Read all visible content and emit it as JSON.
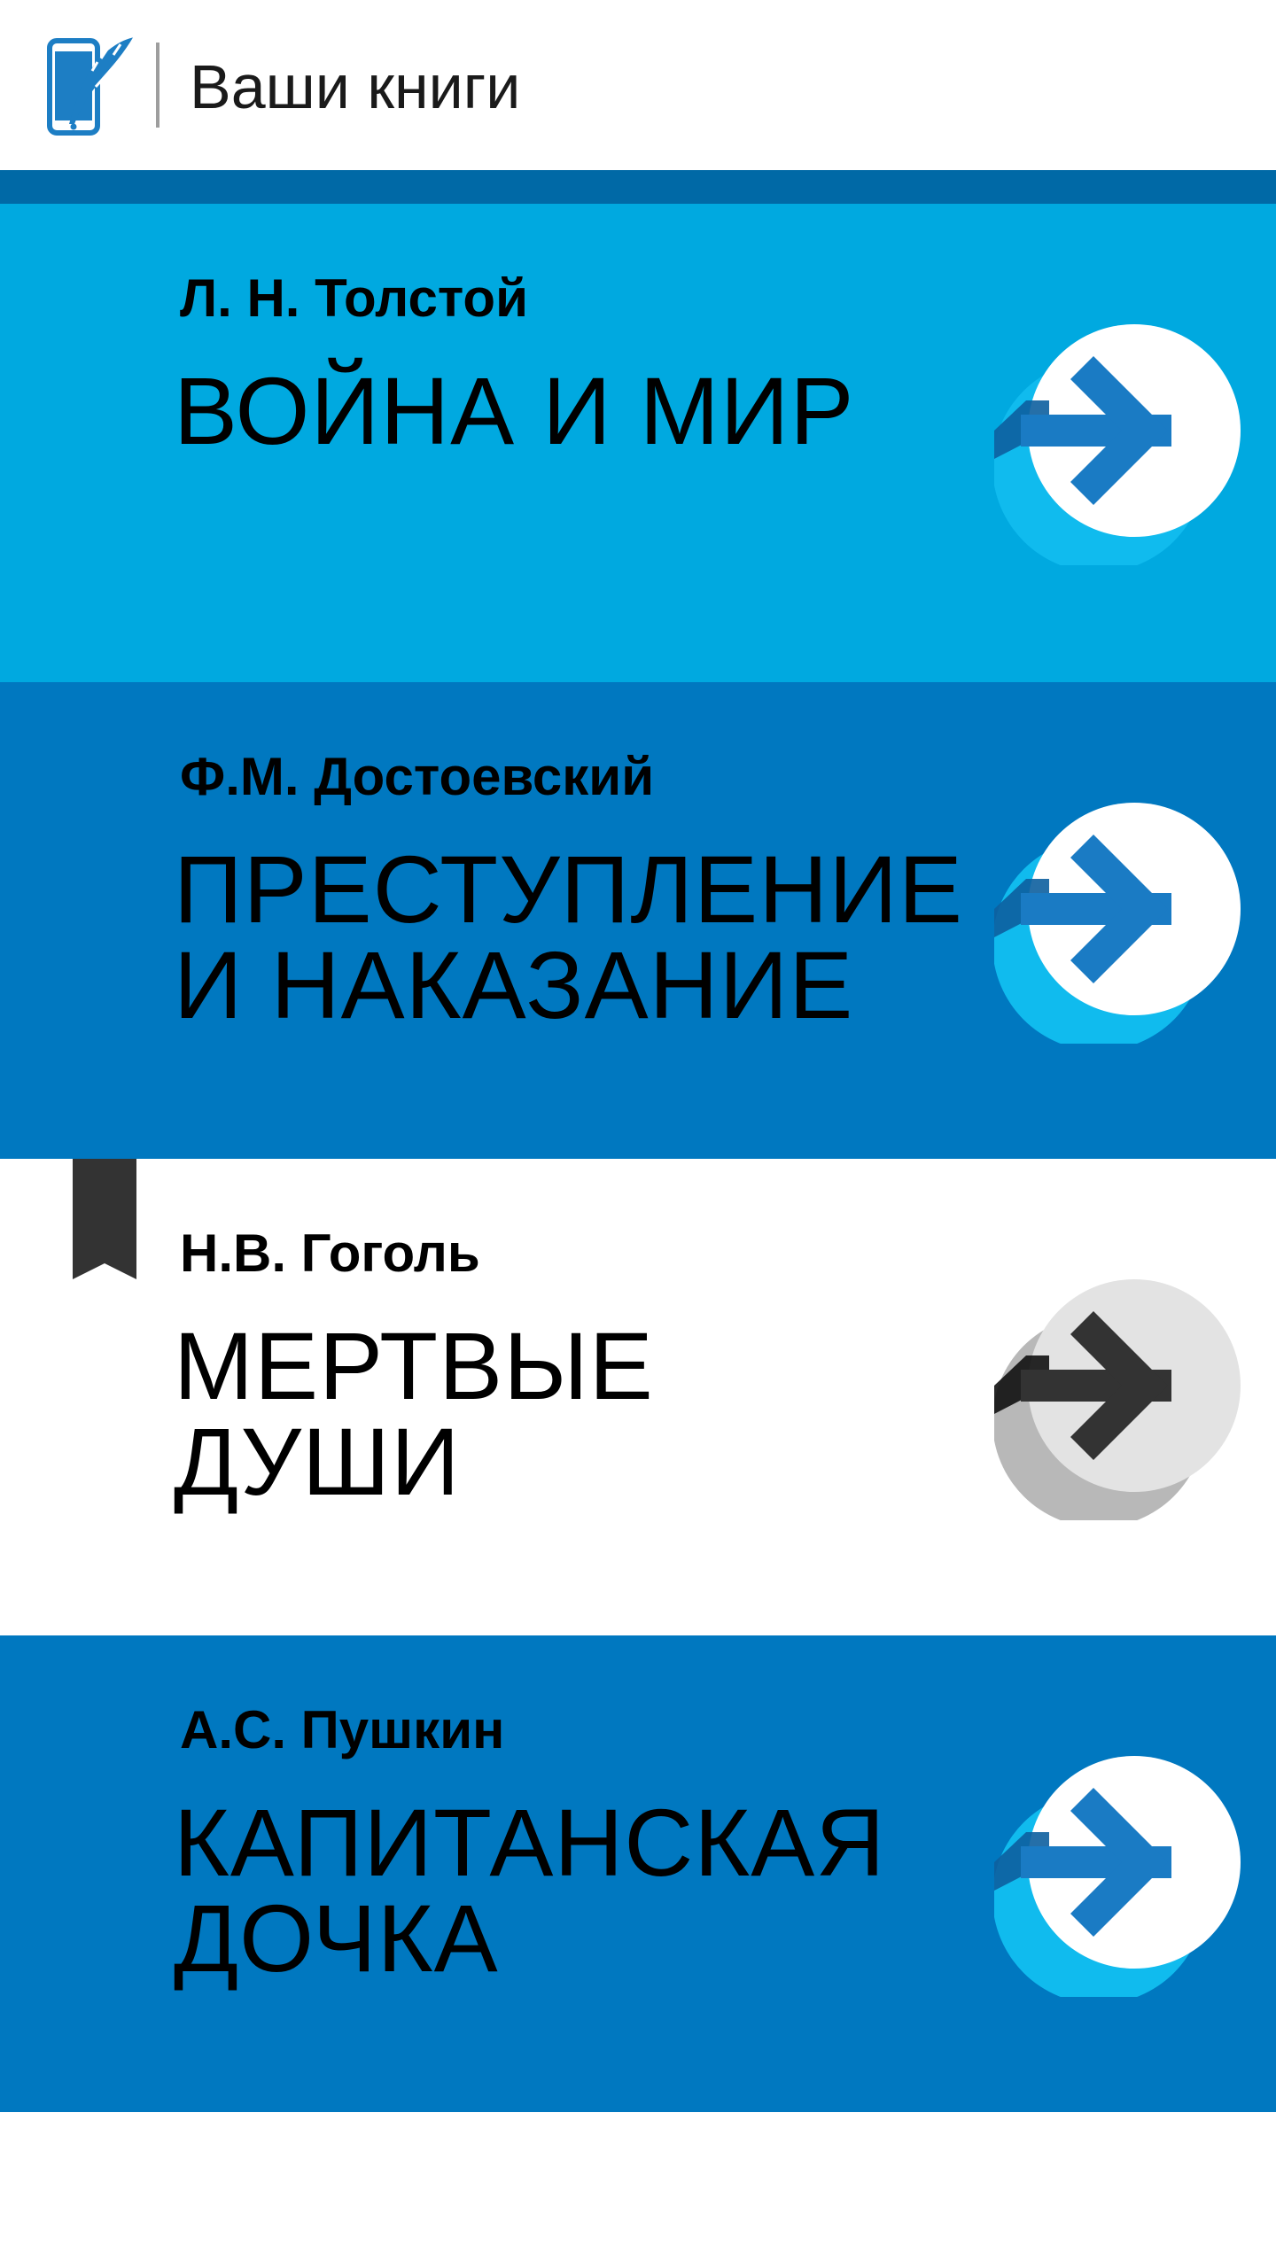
{
  "header": {
    "title": "Ваши книги",
    "logo_icon": "feather-phone-icon",
    "logo_color": "#1d7ec4"
  },
  "colors": {
    "accent_light": "#00a9e0",
    "accent_dark": "#0078c0",
    "strip": "#0069a6",
    "bookmark": "#333333"
  },
  "books": [
    {
      "author": "Л. Н. Толстой",
      "title_lines": [
        "ВОЙНА И МИР"
      ],
      "bookmarked": false,
      "card_color": "#00a9e0",
      "icon": "arrow-right-icon"
    },
    {
      "author": "Ф.М. Достоевский",
      "title_lines": [
        "ПРЕСТУПЛЕНИЕ",
        "И НАКАЗАНИЕ"
      ],
      "bookmarked": false,
      "card_color": "#0078c0",
      "icon": "arrow-right-icon"
    },
    {
      "author": "Н.В. Гоголь",
      "title_lines": [
        "МЕРТВЫЕ",
        "ДУШИ"
      ],
      "bookmarked": true,
      "card_color": "#ffffff",
      "icon": "arrow-right-icon"
    },
    {
      "author": "А.С. Пушкин",
      "title_lines": [
        "КАПИТАНСКАЯ",
        "ДОЧКА"
      ],
      "bookmarked": false,
      "card_color": "#0078c0",
      "icon": "arrow-right-icon"
    }
  ]
}
